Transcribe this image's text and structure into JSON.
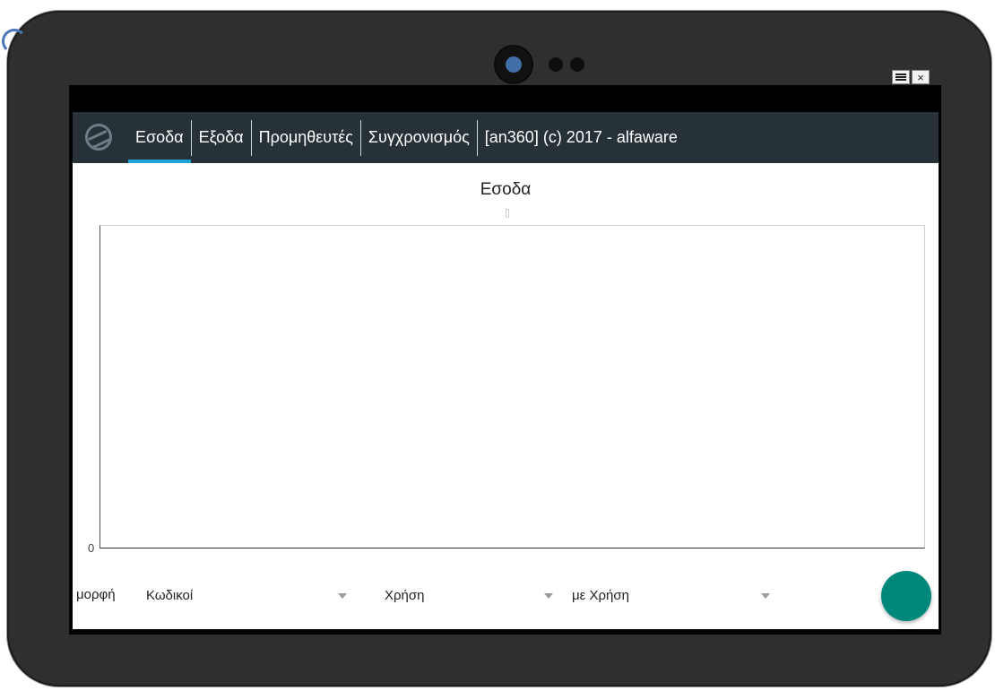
{
  "window": {
    "menu_icon": "hamburger-icon",
    "close_label": "×"
  },
  "nav": {
    "tabs": [
      {
        "label": "Εσοδα",
        "active": true
      },
      {
        "label": "Εξοδα",
        "active": false
      },
      {
        "label": "Προμηθευτές",
        "active": false
      },
      {
        "label": "Συγχρονισμός",
        "active": false
      },
      {
        "label": "[an360] (c) 2017 - alfaware",
        "active": false
      }
    ]
  },
  "chart_data": {
    "type": "bar",
    "title": "Εσοδα",
    "categories": [],
    "values": [],
    "y_tick_labels": [
      "0"
    ],
    "grid": false
  },
  "filters": {
    "format_label": "μορφή",
    "format_value": "Κωδικοί",
    "usage_value": "Χρήση",
    "by_usage_value": "με Χρήση"
  },
  "colors": {
    "navbar": "#263238",
    "active_tab_indicator": "#1ea3d8",
    "fab": "#00897b",
    "frame": "#2f2f2f"
  }
}
